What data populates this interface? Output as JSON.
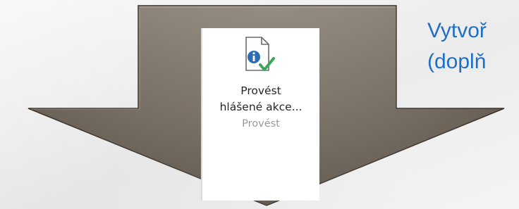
{
  "ribbon": {
    "button_label_line1": "Provést",
    "button_label_line2": "hlášené akce...",
    "group_label": "Provést",
    "icon": "document-info-check-icon"
  },
  "side_text": {
    "line1": "Vytvoř",
    "line2": "(doplň"
  },
  "colors": {
    "arrow_fill_top": "#8a8073",
    "arrow_fill_bottom": "#5f574c",
    "arrow_stroke": "#4a4238",
    "side_text": "#1f6fc4",
    "info_blue": "#2e6db4",
    "check_green": "#3aa65a"
  }
}
